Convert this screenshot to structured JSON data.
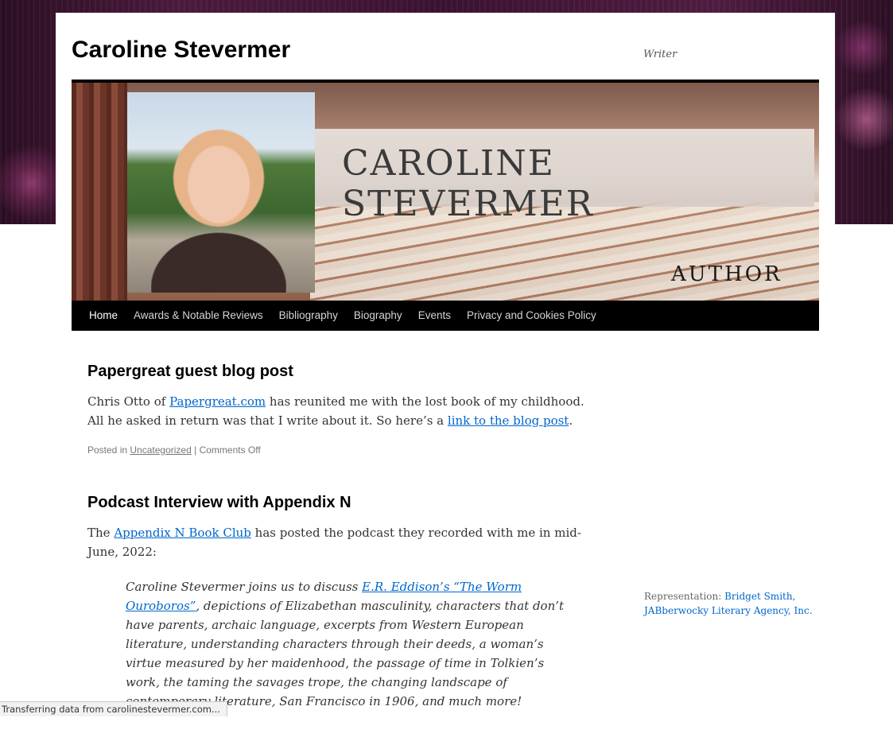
{
  "site": {
    "title": "Caroline Stevermer",
    "tagline": "Writer"
  },
  "banner": {
    "name": "CAROLINE STEVERMER",
    "subtitle": "AUTHOR"
  },
  "nav": {
    "items": [
      {
        "label": "Home"
      },
      {
        "label": "Awards & Notable Reviews"
      },
      {
        "label": "Bibliography"
      },
      {
        "label": "Biography"
      },
      {
        "label": "Events"
      },
      {
        "label": "Privacy and Cookies Policy"
      }
    ]
  },
  "posts": [
    {
      "title": "Papergreat guest blog post",
      "body_1": "Chris Otto of ",
      "link_1": "Papergreat.com",
      "body_2": " has reunited me with the lost book of my childhood. All he asked in return was that I write about it. So here’s a ",
      "link_2": "link to the blog post",
      "body_3": ".",
      "meta_prefix": "Posted in ",
      "meta_category": "Uncategorized",
      "meta_separator": " | ",
      "meta_comments": "Comments Off"
    },
    {
      "title": "Podcast Interview with Appendix N",
      "body_1": "The ",
      "link_1": "Appendix N Book Club",
      "body_2": " has posted the podcast they recorded with me in mid-June, 2022:",
      "quote_1": "Caroline Stevermer joins us to discuss ",
      "quote_link": "E.R. Eddison’s “The Worm Ouroboros”",
      "quote_2": ", depictions of Elizabethan masculinity, characters that don’t have parents, archaic language, excerpts from Western European literature, understanding characters through their deeds, a woman’s virtue measured by her maidenhood, the passage of time in Tolkien’s work, the taming the savages trope, the changing landscape of contemporary literature, San Francisco in 1906, and much more!"
    }
  ],
  "sidebar": {
    "label": "Representation: ",
    "link": "Bridget Smith, JABberwocky Literary Agency, Inc."
  },
  "status_bar": {
    "text": "Transferring data from carolinestevermer.com..."
  }
}
